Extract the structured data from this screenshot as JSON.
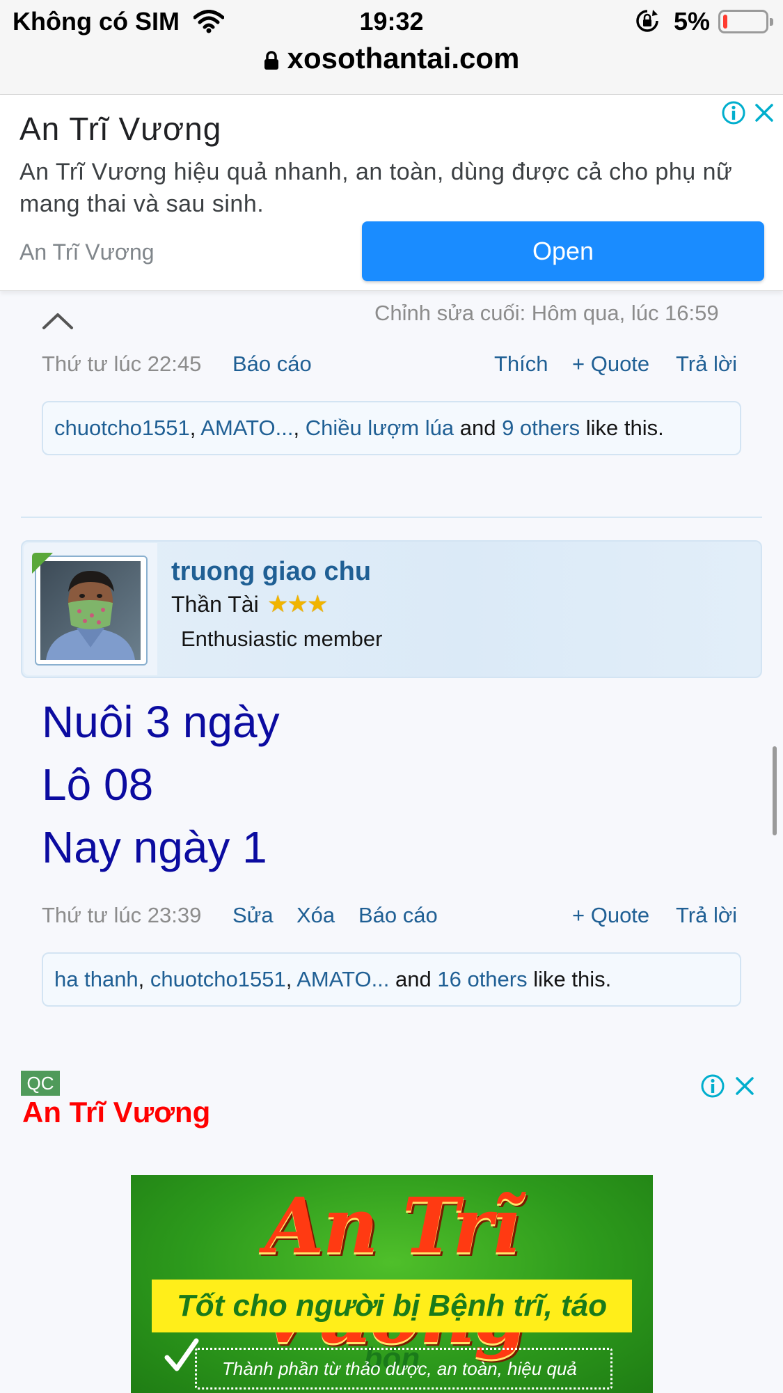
{
  "status_bar": {
    "carrier": "Không có SIM",
    "time": "19:32",
    "battery_percent": "5%",
    "battery_level": 0.05
  },
  "url_bar": {
    "domain": "xosothantai.com"
  },
  "top_ad": {
    "title": "An Trĩ Vương",
    "description_line1": "An Trĩ Vương hiệu quả nhanh, an toàn, dùng được cả cho phụ nữ",
    "description_line2": "mang thai và sau sinh.",
    "advertiser": "An Trĩ Vương",
    "open_label": "Open"
  },
  "post1": {
    "last_edit": "Chỉnh sửa cuối: Hôm qua, lúc 16:59",
    "time": "Thứ tư lúc 22:45",
    "report_label": "Báo cáo",
    "like_label": "Thích",
    "quote_label": "+ Quote",
    "reply_label": "Trả lời",
    "likes": {
      "user1": "chuotcho1551",
      "sep1": ", ",
      "user2": "AMATO...",
      "sep2": ", ",
      "user3": "Chiều lượm lúa",
      "and": " and ",
      "others": "9 others",
      "suffix": " like this."
    }
  },
  "post2": {
    "author": {
      "name": "truong giao chu",
      "title": "Thần Tài",
      "stars": "★★★",
      "rank": "Enthusiastic member"
    },
    "content": [
      "Nuôi 3 ngày",
      "Lô 08",
      "Nay ngày 1"
    ],
    "time": "Thứ tư lúc 23:39",
    "edit_label": "Sửa",
    "delete_label": "Xóa",
    "report_label": "Báo cáo",
    "quote_label": "+ Quote",
    "reply_label": "Trả lời",
    "likes": {
      "user1": "ha thanh",
      "sep1": ", ",
      "user2": "chuotcho1551",
      "sep2": ", ",
      "user3": "AMATO...",
      "and": " and ",
      "others": "16 others",
      "suffix": " like this."
    }
  },
  "bottom_ad": {
    "badge": "QC",
    "title": "An Trĩ Vương",
    "banner_title": "An Trĩ Vương",
    "banner_subtitle": "Tốt cho người bị Bệnh trĩ, táo bón",
    "banner_bullet": "Thành phần từ thảo dược, an toàn, hiệu quả"
  },
  "icons": {
    "lock": "lock-icon",
    "wifi": "wifi-icon",
    "rotation_lock": "rotation-lock-icon",
    "adchoices": "info-icon",
    "close": "close-icon",
    "scroll_up": "chevron-up-icon"
  },
  "colors": {
    "link": "#1f5f94",
    "post_text": "#0b0ba0",
    "open_button": "#1a8cff",
    "ad_title_red": "#ff0000",
    "adchoice_teal": "#00aecd"
  }
}
